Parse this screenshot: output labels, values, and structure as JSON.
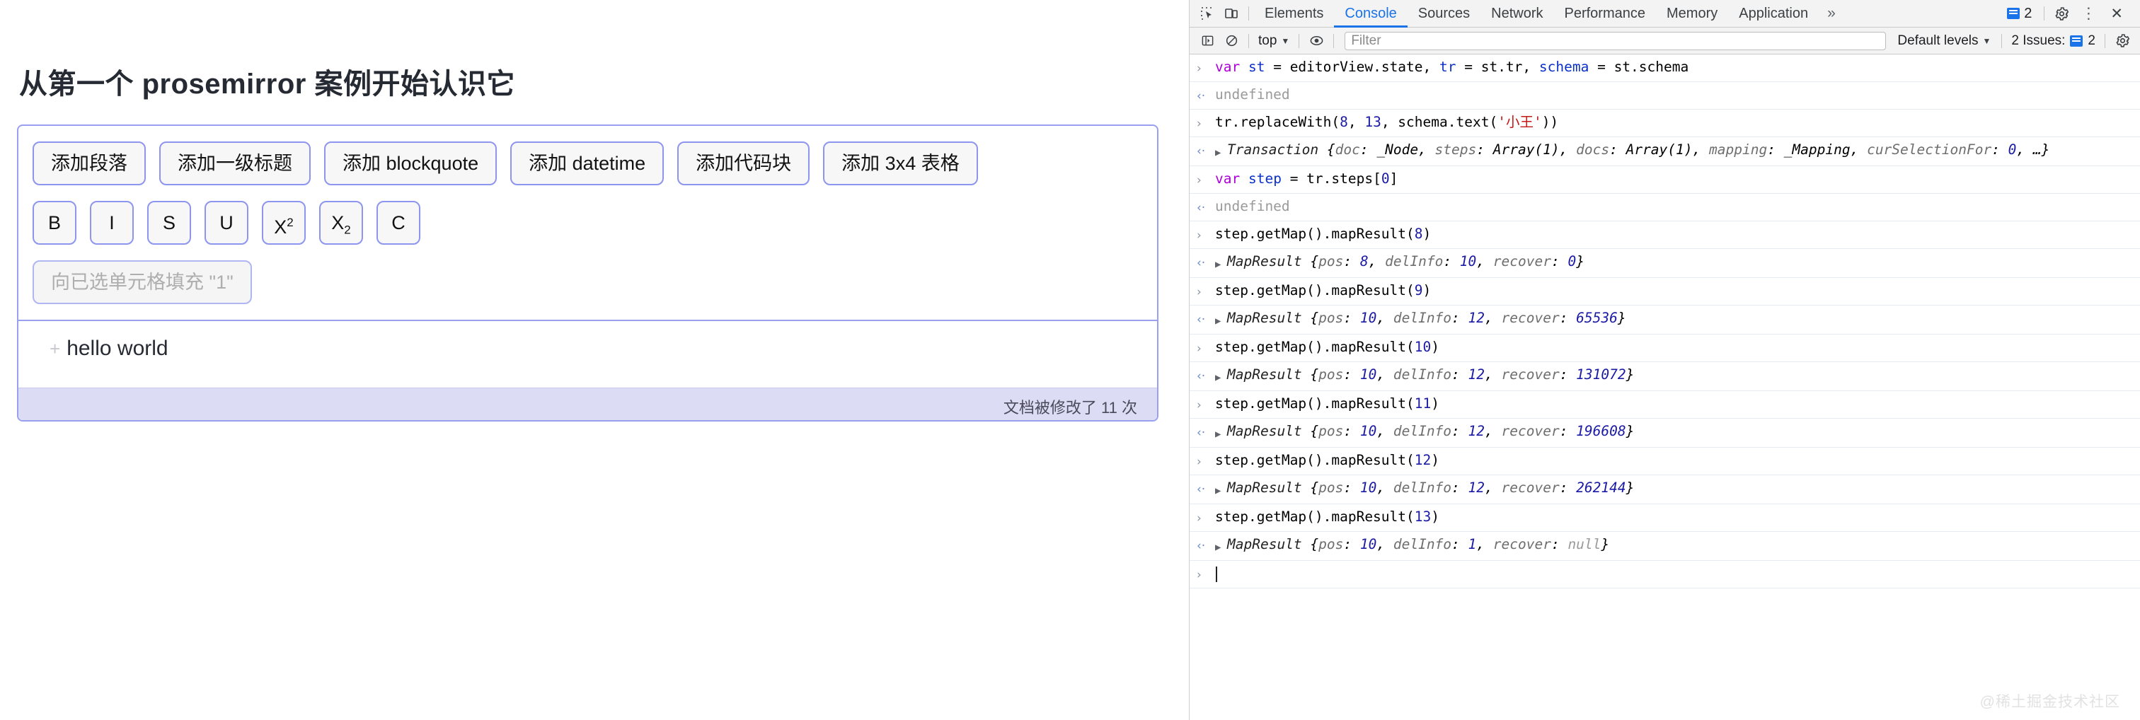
{
  "page": {
    "title": "从第一个 prosemirror 案例开始认识它",
    "toolbar": {
      "block_buttons": [
        {
          "label": "添加段落",
          "name": "add-paragraph-button"
        },
        {
          "label": "添加一级标题",
          "name": "add-heading1-button"
        },
        {
          "label": "添加 blockquote",
          "name": "add-blockquote-button"
        },
        {
          "label": "添加 datetime",
          "name": "add-datetime-button"
        },
        {
          "label": "添加代码块",
          "name": "add-codeblock-button"
        },
        {
          "label": "添加 3x4 表格",
          "name": "add-table-button"
        }
      ],
      "mark_buttons": [
        {
          "label": "B",
          "name": "bold-button"
        },
        {
          "label": "I",
          "name": "italic-button"
        },
        {
          "label": "S",
          "name": "strikethrough-button"
        },
        {
          "label": "U",
          "name": "underline-button"
        },
        {
          "label": "X",
          "sup": "2",
          "name": "superscript-button"
        },
        {
          "label": "X",
          "sub": "2",
          "name": "subscript-button"
        },
        {
          "label": "C",
          "name": "code-button"
        }
      ],
      "fill_cell_button": "向已选单元格填充 \"1\""
    },
    "document": {
      "plus_handle": "+",
      "line": "hello world"
    },
    "status": "文档被修改了 11 次"
  },
  "devtools": {
    "tabs": [
      {
        "label": "Elements",
        "active": false
      },
      {
        "label": "Console",
        "active": true
      },
      {
        "label": "Sources",
        "active": false
      },
      {
        "label": "Network",
        "active": false
      },
      {
        "label": "Performance",
        "active": false
      },
      {
        "label": "Memory",
        "active": false
      },
      {
        "label": "Application",
        "active": false
      }
    ],
    "more_tabs": "»",
    "messages_count": "2",
    "icons": {
      "inspect": "inspect-element-icon",
      "device": "device-toolbar-icon",
      "settings": "gear-icon",
      "kebab": "⋮",
      "close": "✕",
      "sidebar": "console-sidebar-icon",
      "clear": "clear-console-icon",
      "eye": "live-expression-icon"
    },
    "toolbar": {
      "context": "top",
      "filter_placeholder": "Filter",
      "filter_value": "",
      "levels": "Default levels",
      "issues_label": "2 Issues:",
      "issues_count": "2"
    },
    "accent_color": "#1a73e8",
    "annotation_color": "#e8352a",
    "console_lines": [
      {
        "type": "input",
        "html": "<span class=\"kw\">var</span> <span class=\"var\">st</span> = editorView.state, <span class=\"var\">tr</span> = st.tr, <span class=\"var\">schema</span> = st.schema"
      },
      {
        "type": "output",
        "html": "<span class=\"undef\">undefined</span>"
      },
      {
        "type": "input",
        "html": "tr.replaceWith(<span class=\"num\">8</span>, <span class=\"num\">13</span>, schema.text(<span class=\"str\">'小王'</span>))"
      },
      {
        "type": "output",
        "expand": true,
        "html": "<span class=\"objname\">Transaction</span> <span class=\"obj\">{</span><span class=\"prop\">doc</span><span class=\"obj\">: _Node, </span><span class=\"prop\">steps</span><span class=\"obj\">: Array(1), </span><span class=\"prop\">docs</span><span class=\"obj\">: Array(1), </span><span class=\"prop\">mapping</span><span class=\"obj\">: _Mapping, </span><span class=\"prop\">curSelectionFor</span><span class=\"obj\">: </span><span class=\"num obj\">0</span><span class=\"obj\">, …}</span>"
      },
      {
        "type": "input",
        "html": "<span class=\"kw\">var</span> <span class=\"var\">step</span> = tr.steps[<span class=\"num\">0</span>]"
      },
      {
        "type": "output",
        "html": "<span class=\"undef\">undefined</span>"
      },
      {
        "type": "input",
        "html": "step.getMap().mapResult(<span class=\"num\">8</span>)"
      },
      {
        "type": "output",
        "expand": true,
        "html": "<span class=\"objname\">MapResult</span> <span class=\"obj\">{</span><span class=\"prop\">pos</span><span class=\"obj\">: </span><span class=\"num obj\">8</span><span class=\"obj\">, </span><span class=\"prop\">delInfo</span><span class=\"obj\">: </span><span class=\"num obj\">10</span><span class=\"obj\">, </span><span class=\"prop\">recover</span><span class=\"obj\">: </span><span class=\"num obj\">0</span><span class=\"obj\">}</span>"
      },
      {
        "type": "input",
        "html": "step.getMap().mapResult(<span class=\"num\">9</span>)"
      },
      {
        "type": "output",
        "expand": true,
        "html": "<span class=\"objname\">MapResult</span> <span class=\"obj\">{</span><span class=\"prop\">pos</span><span class=\"obj\">: </span><span class=\"num obj\">10</span><span class=\"obj\">, </span><span class=\"prop\">delInfo</span><span class=\"obj\">: </span><span class=\"num obj\">12</span><span class=\"obj\">, </span><span class=\"prop\">recover</span><span class=\"obj\">: </span><span class=\"num obj\">65536</span><span class=\"obj\">}</span>"
      },
      {
        "type": "input",
        "html": "step.getMap().mapResult(<span class=\"num\">10</span>)"
      },
      {
        "type": "output",
        "expand": true,
        "html": "<span class=\"objname\">MapResult</span> <span class=\"obj\">{</span><span class=\"prop\">pos</span><span class=\"obj\">: </span><span class=\"num obj\">10</span><span class=\"obj\">, </span><span class=\"prop\">delInfo</span><span class=\"obj\">: </span><span class=\"num obj\">12</span><span class=\"obj\">, </span><span class=\"prop\">recover</span><span class=\"obj\">: </span><span class=\"num obj\">131072</span><span class=\"obj\">}</span>"
      },
      {
        "type": "input",
        "html": "step.getMap().mapResult(<span class=\"num\">11</span>)"
      },
      {
        "type": "output",
        "expand": true,
        "html": "<span class=\"objname\">MapResult</span> <span class=\"obj\">{</span><span class=\"prop\">pos</span><span class=\"obj\">: </span><span class=\"num obj\">10</span><span class=\"obj\">, </span><span class=\"prop\">delInfo</span><span class=\"obj\">: </span><span class=\"num obj\">12</span><span class=\"obj\">, </span><span class=\"prop\">recover</span><span class=\"obj\">: </span><span class=\"num obj\">196608</span><span class=\"obj\">}</span>"
      },
      {
        "type": "input",
        "html": "step.getMap().mapResult(<span class=\"num\">12</span>)"
      },
      {
        "type": "output",
        "expand": true,
        "html": "<span class=\"objname\">MapResult</span> <span class=\"obj\">{</span><span class=\"prop\">pos</span><span class=\"obj\">: </span><span class=\"num obj\">10</span><span class=\"obj\">, </span><span class=\"prop\">delInfo</span><span class=\"obj\">: </span><span class=\"num obj\">12</span><span class=\"obj\">, </span><span class=\"prop\">recover</span><span class=\"obj\">: </span><span class=\"num obj\">262144</span><span class=\"obj\">}</span>"
      },
      {
        "type": "input",
        "html": "step.getMap().mapResult(<span class=\"num\">13</span>)"
      },
      {
        "type": "output",
        "expand": true,
        "html": "<span class=\"objname\">MapResult</span> <span class=\"obj\">{</span><span class=\"prop\">pos</span><span class=\"obj\">: </span><span class=\"num obj\">10</span><span class=\"obj\">, </span><span class=\"prop\">delInfo</span><span class=\"obj\">: </span><span class=\"num obj\">1</span><span class=\"obj\">, </span><span class=\"prop\">recover</span><span class=\"obj\">: </span><span class=\"nul\">null</span><span class=\"obj\">}</span>"
      },
      {
        "type": "prompt",
        "html": "<span class=\"prompt-caret\"></span>"
      }
    ]
  },
  "watermark": "@稀土掘金技术社区"
}
